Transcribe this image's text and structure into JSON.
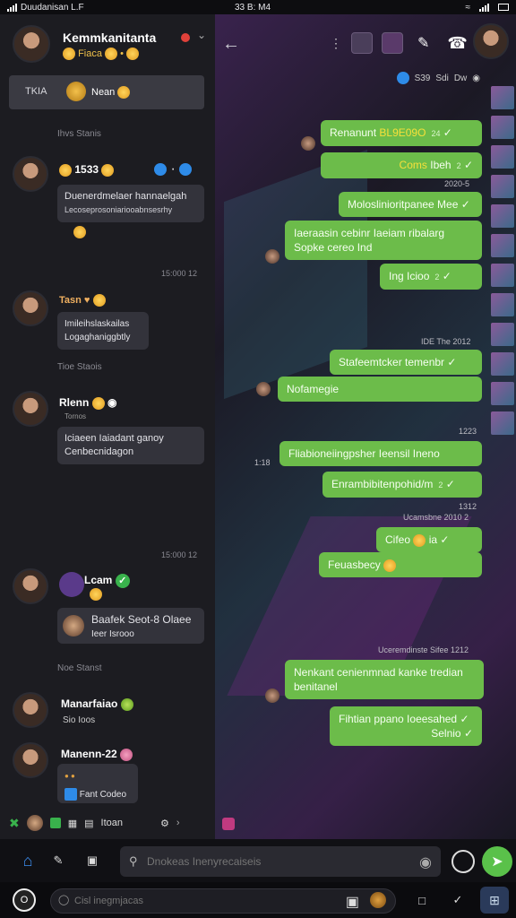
{
  "status": {
    "left": "Duudanisan L.F",
    "time": "33 B: M4"
  },
  "left": {
    "header": {
      "title": "Kemmkanitanta",
      "subtitle": "Fiaca"
    },
    "search": {
      "tag": "TKIA",
      "label": "Nean"
    },
    "chats": [
      {
        "date": "Ihvs Stanis",
        "name": "1533",
        "preview1": "Duenerdmelaer hannaelgah",
        "preview2": "Lecoseprosoniariooabnsesrhy",
        "time": "15:000 12"
      },
      {
        "name": "Tasn",
        "preview1": "Imileihslaskailas",
        "preview2": "Logaghaniggbtly",
        "date2": "Tioe Staois"
      },
      {
        "name": "Rlenn",
        "meta": "Tornos",
        "preview1": "Iciaeen Iaiadant ganoy",
        "preview2": "Cenbecnidagon",
        "time": "15:000 12"
      },
      {
        "name": "Lcam",
        "preview1": "Baafek Seot-8 Olaee",
        "preview2": "Ieer Isrooo",
        "date2": "Noe Stanst"
      },
      {
        "name": "Manarfaiao",
        "preview1": "Sio Ioos"
      },
      {
        "name": "Manenn-22",
        "preview1": "Fant Codeo"
      }
    ],
    "footer": {
      "label": "Itoan"
    }
  },
  "right": {
    "sub": [
      "S39",
      "Sdi",
      "Dw"
    ],
    "messages": [
      {
        "text": "Renanunt",
        "hl": "BL9E09O",
        "meta": "24"
      },
      {
        "text": "",
        "hl": "Coms",
        "text2": "Ibeh",
        "meta": "2"
      },
      {
        "date": "2020-5"
      },
      {
        "text": "Moloslinioritpanee Mee",
        "meta": ""
      },
      {
        "text": "Iaeraasin cebinr Iaeiam ribalarg",
        "text2": "Sopke cereo Ind"
      },
      {
        "text": "Ing Icioo",
        "meta": "2"
      },
      {
        "date": "IDE The 2012"
      },
      {
        "text": "Stafeemtcker temenbr",
        "meta": ""
      },
      {
        "text": "Nofamegie"
      },
      {
        "date": "1223",
        "side": "1:18"
      },
      {
        "text": "Fliabioneiingpsher Ieensil Ineno"
      },
      {
        "text": "Enrambibitenpohid/m",
        "meta": "2"
      },
      {
        "date": "1312",
        "date2": "Ucamsbne 2010 2"
      },
      {
        "text": "Cifeo",
        "text2": "ia",
        "meta": ""
      },
      {
        "text": "Feuasbecy"
      },
      {
        "date": "Uceremdinste Sifee 1212"
      },
      {
        "text": "Nenkant cenienmnad kanke tredian",
        "text2": "benitanel"
      },
      {
        "text": "Fihtian ppano Ioeesahed",
        "text2": "Selnio"
      }
    ]
  },
  "bottom": {
    "placeholder": "Dnokeas Inenyrecaiseis",
    "placeholder2": "Cisl inegmjacas"
  }
}
